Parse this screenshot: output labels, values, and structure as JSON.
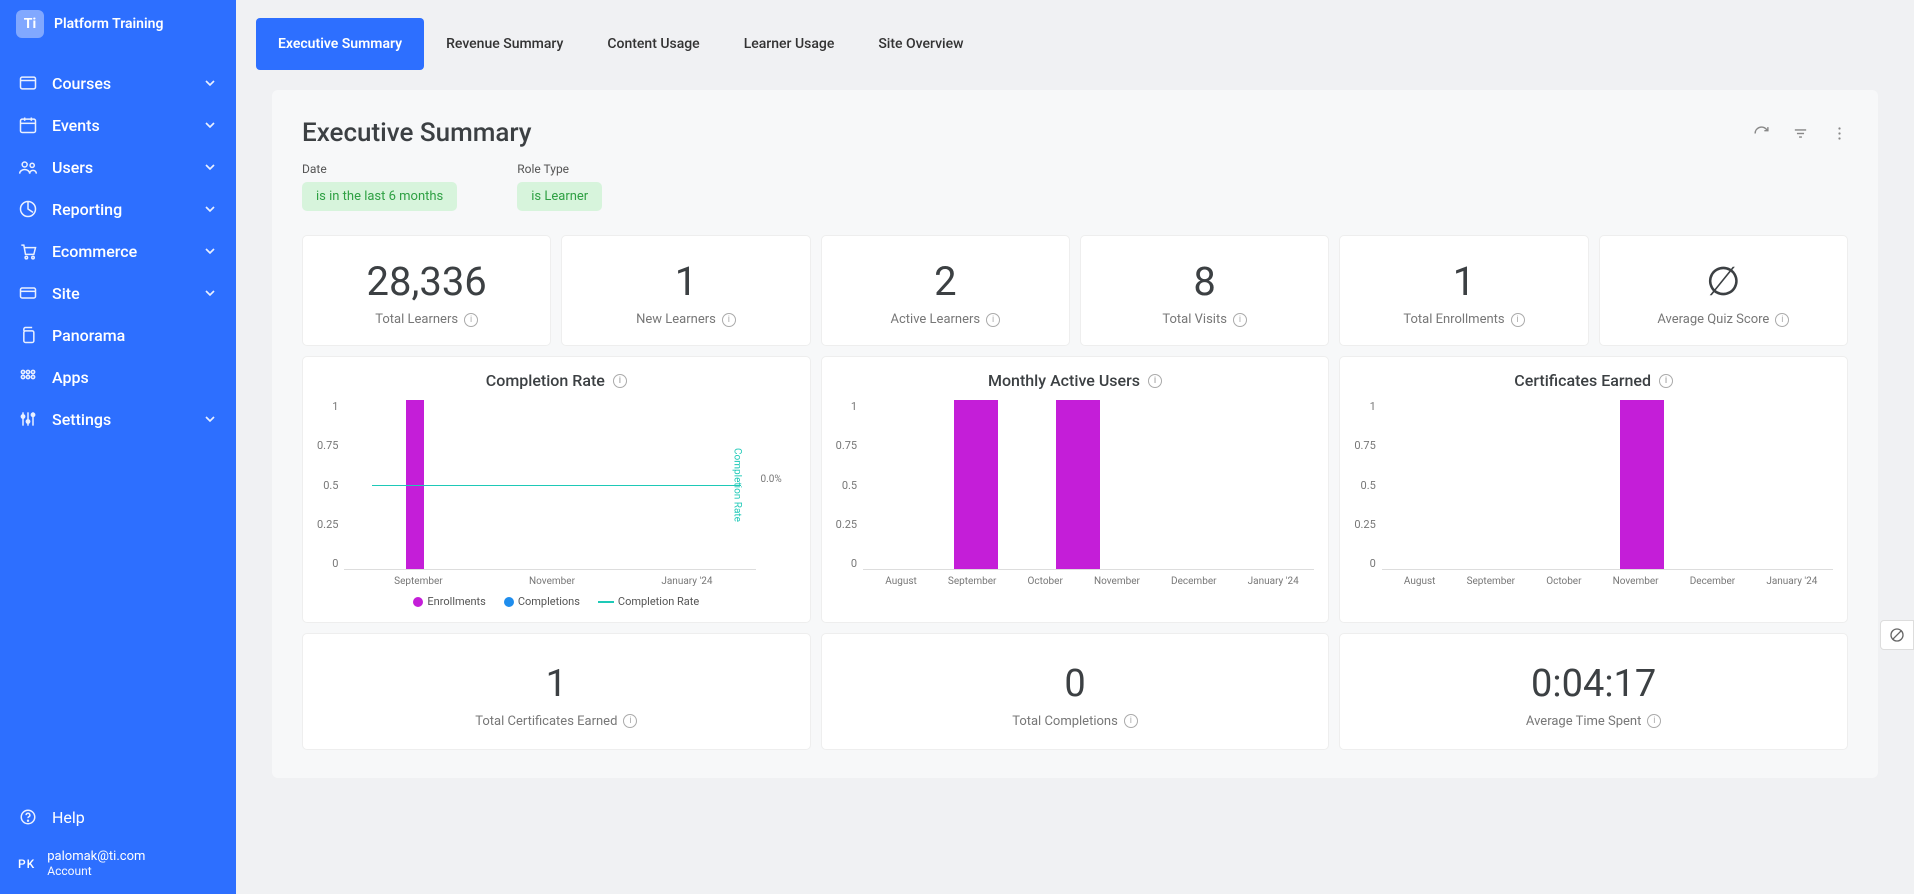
{
  "brand": {
    "logo": "Ti",
    "name": "Platform Training"
  },
  "sidebar": {
    "items": [
      {
        "label": "Courses",
        "icon": "browser",
        "expandable": true
      },
      {
        "label": "Events",
        "icon": "calendar",
        "expandable": true
      },
      {
        "label": "Users",
        "icon": "people",
        "expandable": true
      },
      {
        "label": "Reporting",
        "icon": "chart",
        "expandable": true
      },
      {
        "label": "Ecommerce",
        "icon": "cart",
        "expandable": true
      },
      {
        "label": "Site",
        "icon": "card",
        "expandable": true
      },
      {
        "label": "Panorama",
        "icon": "copy",
        "expandable": false
      },
      {
        "label": "Apps",
        "icon": "grid",
        "expandable": false
      },
      {
        "label": "Settings",
        "icon": "sliders",
        "expandable": true
      }
    ],
    "help": "Help",
    "user": {
      "initials": "PK",
      "email": "palomak@ti.com",
      "sub": "Account"
    }
  },
  "tabs": [
    {
      "label": "Executive Summary",
      "active": true
    },
    {
      "label": "Revenue Summary",
      "active": false
    },
    {
      "label": "Content Usage",
      "active": false
    },
    {
      "label": "Learner Usage",
      "active": false
    },
    {
      "label": "Site Overview",
      "active": false
    }
  ],
  "dashboard": {
    "title": "Executive Summary",
    "filters": [
      {
        "label": "Date",
        "value": "is in the last 6 months"
      },
      {
        "label": "Role Type",
        "value": "is Learner"
      }
    ],
    "kpis": [
      {
        "value": "28,336",
        "label": "Total Learners"
      },
      {
        "value": "1",
        "label": "New Learners"
      },
      {
        "value": "2",
        "label": "Active Learners"
      },
      {
        "value": "8",
        "label": "Total Visits"
      },
      {
        "value": "1",
        "label": "Total Enrollments"
      },
      {
        "value": "∅",
        "label": "Average Quiz Score"
      }
    ],
    "charts": [
      {
        "title": "Completion Rate"
      },
      {
        "title": "Monthly Active Users"
      },
      {
        "title": "Certificates Earned"
      }
    ],
    "big_kpis": [
      {
        "value": "1",
        "label": "Total Certificates Earned"
      },
      {
        "value": "0",
        "label": "Total Completions"
      },
      {
        "value": "0:04:17",
        "label": "Average Time Spent"
      }
    ]
  },
  "chart_data": [
    {
      "type": "bar+line",
      "title": "Completion Rate",
      "y_ticks": [
        "1",
        "0.75",
        "0.5",
        "0.25",
        "0"
      ],
      "x_ticks": [
        "September",
        "November",
        "January '24"
      ],
      "series": [
        {
          "name": "Enrollments",
          "kind": "bar",
          "color": "#c41ed8",
          "categories": [
            "September"
          ],
          "values": [
            1
          ]
        },
        {
          "name": "Completions",
          "kind": "bar",
          "color": "#1f8ded",
          "categories": [],
          "values": []
        },
        {
          "name": "Completion Rate",
          "kind": "line",
          "color": "#1ec9b7",
          "value_pct": 0.0
        }
      ],
      "right_label": "0.0%",
      "y2_label": "Completion Rate",
      "legend": [
        "Enrollments",
        "Completions",
        "Completion Rate"
      ]
    },
    {
      "type": "bar",
      "title": "Monthly Active Users",
      "y_ticks": [
        "1",
        "0.75",
        "0.5",
        "0.25",
        "0"
      ],
      "categories": [
        "August",
        "September",
        "October",
        "November",
        "December",
        "January '24"
      ],
      "values": [
        0,
        1,
        1,
        0,
        0,
        0
      ],
      "color": "#c41ed8"
    },
    {
      "type": "bar",
      "title": "Certificates Earned",
      "y_ticks": [
        "1",
        "0.75",
        "0.5",
        "0.25",
        "0"
      ],
      "categories": [
        "August",
        "September",
        "October",
        "November",
        "December",
        "January '24"
      ],
      "values": [
        0,
        0,
        0,
        1,
        0,
        0
      ],
      "color": "#c41ed8"
    }
  ]
}
